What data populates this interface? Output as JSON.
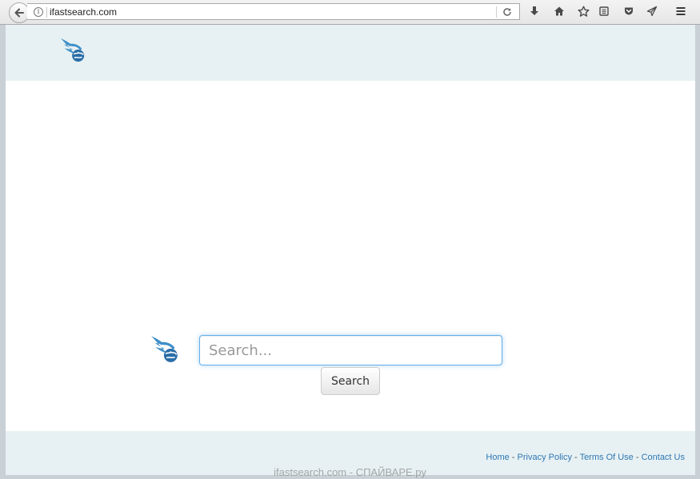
{
  "browser": {
    "url": "ifastsearch.com"
  },
  "toolbar_icons": [
    "back-arrow-icon",
    "info-icon",
    "reload-icon",
    "download-icon",
    "home-icon",
    "star-icon",
    "reading-list-icon",
    "pocket-icon",
    "send-icon",
    "menu-icon"
  ],
  "search": {
    "placeholder": "Search...",
    "value": "",
    "button_label": "Search"
  },
  "footer": {
    "links": [
      "Home",
      "Privacy Policy",
      "Terms Of Use",
      "Contact Us"
    ],
    "separator": " - "
  },
  "watermark": "ifastsearch.com - СПАЙВАРЕ.ру",
  "colors": {
    "brand_blue": "#3f8fc8",
    "band_background": "#e7f1f3",
    "link_color": "#2f77b3",
    "input_focus": "#66afe9"
  }
}
